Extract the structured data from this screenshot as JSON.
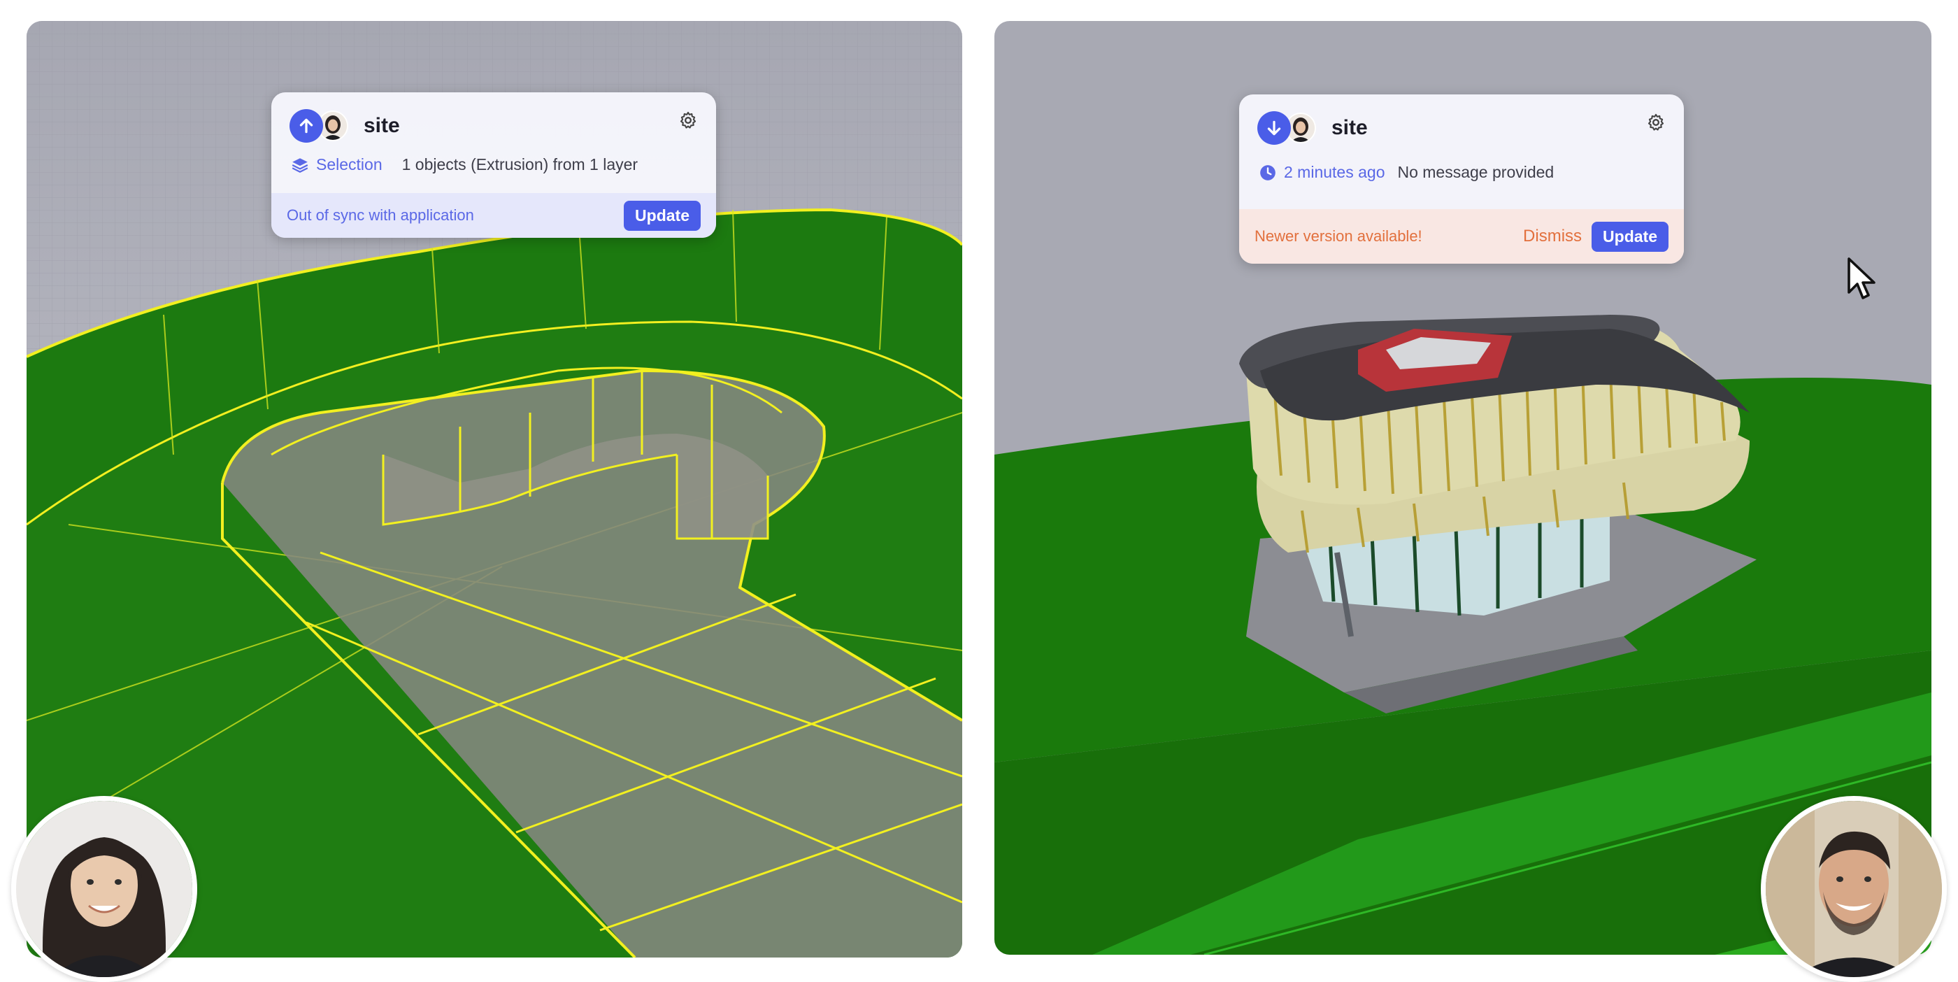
{
  "left_panel": {
    "card": {
      "title": "site",
      "direction_icon": "arrow-up-icon",
      "selection_label": "Selection",
      "selection_summary": "1 objects (Extrusion) from 1 layer",
      "status_message": "Out of sync with application",
      "update_label": "Update"
    }
  },
  "right_panel": {
    "card": {
      "title": "site",
      "direction_icon": "arrow-down-icon",
      "time_ago": "2 minutes ago",
      "message": "No message provided",
      "status_message": "Newer version available!",
      "dismiss_label": "Dismiss",
      "update_label": "Update"
    }
  },
  "colors": {
    "accent": "#4a5de8",
    "accent_text": "#5a68e6",
    "warning": "#e2703d",
    "ground_green": "#1f7d12",
    "wire_yellow": "#f2f020"
  }
}
